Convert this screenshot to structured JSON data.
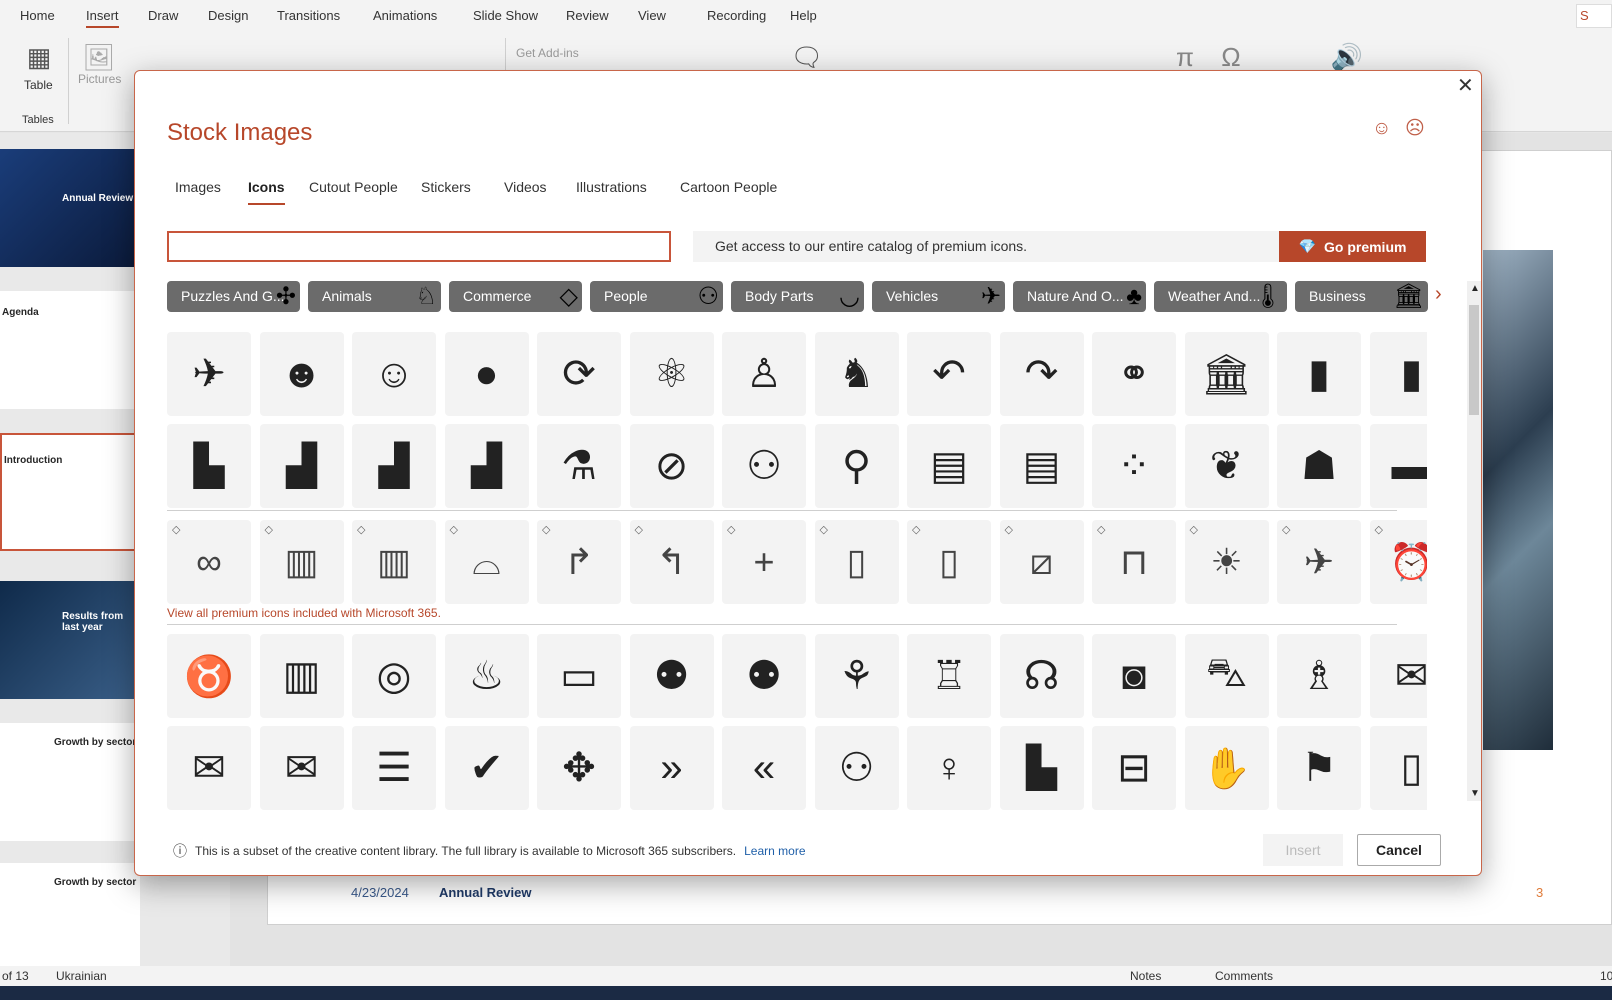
{
  "ribbon": {
    "tabs": [
      "Home",
      "Insert",
      "Draw",
      "Design",
      "Transitions",
      "Animations",
      "Slide Show",
      "Review",
      "View",
      "Recording",
      "Help"
    ],
    "active_tab": "Insert",
    "table_label": "Table",
    "pictures_label": "Pictures",
    "tables_group": "Tables",
    "addins_label": "Get Add-ins",
    "share_label": "S"
  },
  "slides": {
    "thumbs": [
      "Annual Review",
      "Agenda",
      "Introduction",
      "Results from last year",
      "Growth by sector",
      "Growth by sector"
    ],
    "footer_date": "4/23/2024",
    "footer_title": "Annual Review",
    "page_number": "3"
  },
  "status": {
    "slide_count": "of 13",
    "language": "Ukrainian",
    "notes": "Notes",
    "comments": "Comments",
    "zoom": "10"
  },
  "dialog": {
    "title": "Stock Images",
    "close": "✕",
    "tabs": [
      "Images",
      "Icons",
      "Cutout People",
      "Stickers",
      "Videos",
      "Illustrations",
      "Cartoon People"
    ],
    "active_tab": "Icons",
    "search_value": "",
    "banner": "Get access to our entire catalog of premium icons.",
    "premium_button": "Go premium",
    "categories": [
      {
        "label": "Puzzles And G...",
        "icon": "puzzle"
      },
      {
        "label": "Animals",
        "icon": "rabbit"
      },
      {
        "label": "Commerce",
        "icon": "diamond"
      },
      {
        "label": "People",
        "icon": "dancers"
      },
      {
        "label": "Body Parts",
        "icon": "lips"
      },
      {
        "label": "Vehicles",
        "icon": "airplane"
      },
      {
        "label": "Nature And O...",
        "icon": "tree"
      },
      {
        "label": "Weather And...",
        "icon": "thermometer"
      },
      {
        "label": "Business",
        "icon": "bank"
      }
    ],
    "rows_free_top": [
      [
        "airplane",
        "smiley-filled",
        "smiley-outline",
        "apple",
        "refresh",
        "atom",
        "baby",
        "crawling-baby",
        "reply",
        "forward",
        "balloons",
        "bank",
        "bar-chart",
        "bar-chart"
      ],
      [
        "chart-down",
        "chart-up",
        "chart-up",
        "chart-up",
        "beaker",
        "eye-slash",
        "meeting",
        "weightlifter",
        "books",
        "books",
        "dots",
        "brain",
        "head-brain",
        "briefcase"
      ]
    ],
    "rows_premium": [
      [
        "3d-glasses",
        "abacus",
        "abacus",
        "acorn",
        "arrow-right",
        "arrow-left",
        "plus",
        "contact-book",
        "contact-book",
        "bandage",
        "billboard",
        "farm",
        "airplane",
        "alarm-clock"
      ]
    ],
    "premium_link": "View all premium icons included with Microsoft 365.",
    "rows_free_bottom": [
      [
        "dinosaur",
        "building",
        "target",
        "fast-food",
        "bus",
        "people-chart",
        "people-chart",
        "butterfly",
        "cake",
        "person-headset",
        "camera",
        "car",
        "cat",
        "chat"
      ],
      [
        "chat",
        "chat",
        "checklist",
        "check",
        "hands-together",
        "chevrons-right",
        "chevrons-left",
        "group",
        "person-balloon",
        "city",
        "clapperboard",
        "clapping",
        "teacher",
        "clipboard"
      ]
    ],
    "footer_text": "This is a subset of the creative content library. The full library is available to Microsoft 365 subscribers.",
    "learn_more": "Learn more",
    "insert_button": "Insert",
    "cancel_button": "Cancel"
  },
  "colors": {
    "accent": "#b7472a",
    "chip": "#6b6b6b",
    "link": "#1f5fa8"
  }
}
